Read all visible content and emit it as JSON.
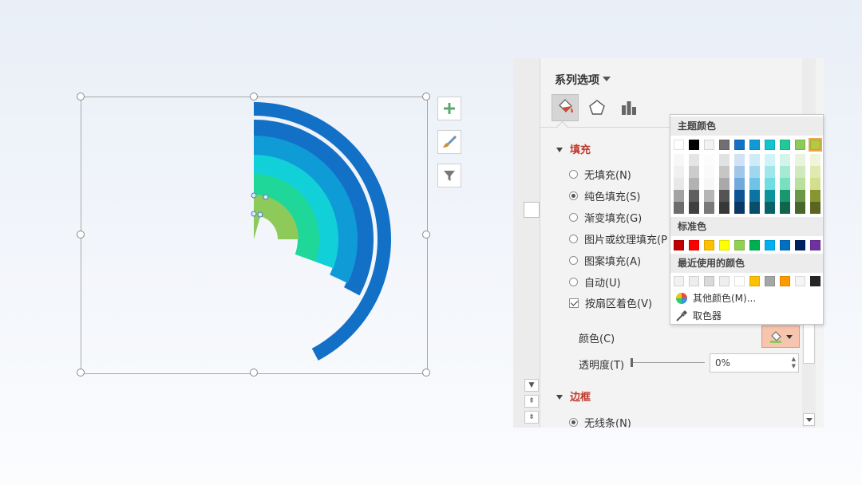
{
  "colors": {
    "pie_outer": "#1270c7",
    "pie_ring2": "#0f9bd6",
    "pie_ring3": "#11d0d8",
    "pie_ring4": "#20d79a",
    "pie_inner": "#8dca5a",
    "highlight": "#c0392b"
  },
  "chart_tools": [
    {
      "name": "chart-elements-button",
      "icon": "plus-icon"
    },
    {
      "name": "chart-styles-button",
      "icon": "brush-icon"
    },
    {
      "name": "chart-filters-button",
      "icon": "filter-icon"
    }
  ],
  "panel": {
    "title": "系列选项",
    "tabs": [
      {
        "name": "tab-fill-line",
        "icon": "paint-bucket-icon",
        "active": true
      },
      {
        "name": "tab-effects",
        "icon": "pentagon-icon",
        "active": false
      },
      {
        "name": "tab-series-options",
        "icon": "bar-chart-icon",
        "active": false
      }
    ],
    "fill_section": "填充",
    "fill_options": [
      {
        "label": "无填充(N)",
        "selected": false
      },
      {
        "label": "纯色填充(S)",
        "selected": true
      },
      {
        "label": "渐变填充(G)",
        "selected": false
      },
      {
        "label": "图片或纹理填充(P",
        "selected": false
      },
      {
        "label": "图案填充(A)",
        "selected": false
      },
      {
        "label": "自动(U)",
        "selected": false
      }
    ],
    "vary_by_slice": "按扇区着色(V)",
    "color_label": "颜色(C)",
    "transparency_label": "透明度(T)",
    "transparency_value": "0%",
    "border_section": "边框",
    "border_option": "无线条(N)"
  },
  "color_popup": {
    "theme_colors_title": "主题颜色",
    "theme_colors": [
      "#ffffff",
      "#000000",
      "#f2f2f2",
      "#707070",
      "#1270c7",
      "#0f9bd6",
      "#11c4d0",
      "#20c997",
      "#8dca5a",
      "#b5c842"
    ],
    "theme_selected_index": 9,
    "standard_colors_title": "标准色",
    "standard_colors": [
      "#c00000",
      "#ff0000",
      "#ffc000",
      "#ffff00",
      "#92d050",
      "#00b050",
      "#00b0f0",
      "#0070c0",
      "#002060",
      "#7030a0"
    ],
    "recent_colors_title": "最近使用的颜色",
    "recent_colors": [
      "#f2f2f2",
      "#ededed",
      "#d9d9d9",
      "#eeeeee",
      "#ffffff",
      "#ffc000",
      "#a6a6a6",
      "#ff9900",
      "#f5f5f5",
      "#262626"
    ],
    "more_colors": "其他颜色(M)...",
    "eyedropper": "取色器"
  }
}
